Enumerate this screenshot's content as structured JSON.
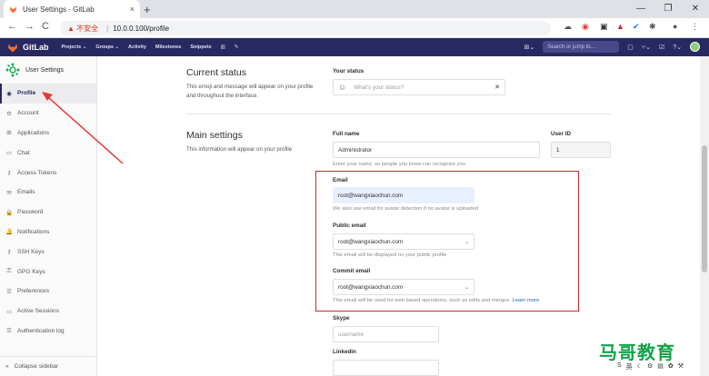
{
  "browser": {
    "tab_title": "User Settings · GitLab",
    "tab_close": "×",
    "new_tab": "+",
    "window_controls": [
      "—",
      "❐",
      "✕"
    ],
    "back": "←",
    "forward": "→",
    "reload": "C",
    "security_warning": "▲ 不安全",
    "url": "10.0.0.100/profile"
  },
  "gitlab_nav": {
    "brand": "GitLab",
    "menu": [
      "Projects ⌄",
      "Groups ⌄",
      "Activity",
      "Milestones",
      "Snippets"
    ],
    "search_placeholder": "Search or jump to…"
  },
  "sidebar": {
    "title": "User Settings",
    "items": [
      {
        "label": "Profile",
        "icon": "user-icon",
        "glyph": "◉",
        "active": true
      },
      {
        "label": "Account",
        "icon": "gear-icon",
        "glyph": "⚙"
      },
      {
        "label": "Applications",
        "icon": "applications-icon",
        "glyph": "⊞"
      },
      {
        "label": "Chat",
        "icon": "chat-icon",
        "glyph": "▭"
      },
      {
        "label": "Access Tokens",
        "icon": "key-icon",
        "glyph": "⚷"
      },
      {
        "label": "Emails",
        "icon": "mail-icon",
        "glyph": "✉"
      },
      {
        "label": "Password",
        "icon": "lock-icon",
        "glyph": "🔒"
      },
      {
        "label": "Notifications",
        "icon": "bell-icon",
        "glyph": "🔔"
      },
      {
        "label": "SSH Keys",
        "icon": "ssh-key-icon",
        "glyph": "⚷"
      },
      {
        "label": "GPG Keys",
        "icon": "gpg-key-icon",
        "glyph": "⚿"
      },
      {
        "label": "Preferences",
        "icon": "preferences-icon",
        "glyph": "☰"
      },
      {
        "label": "Active Sessions",
        "icon": "sessions-icon",
        "glyph": "▭"
      },
      {
        "label": "Authentication log",
        "icon": "log-icon",
        "glyph": "☰"
      }
    ],
    "collapse": "Collapse sidebar"
  },
  "status": {
    "title": "Current status",
    "description": "This emoji and message will appear on your profile and throughout the interface.",
    "label": "Your status",
    "placeholder": "What's your status?",
    "clear": "✕"
  },
  "main_settings": {
    "title": "Main settings",
    "description": "This information will appear on your profile",
    "full_name_label": "Full name",
    "full_name_value": "Administrator",
    "full_name_help": "Enter your name, so people you know can recognize you",
    "user_id_label": "User ID",
    "user_id_value": "1",
    "email_label": "Email",
    "email_value": "root@wangxiaochun.com",
    "email_help": "We also use email for avatar detection if no avatar is uploaded",
    "public_email_label": "Public email",
    "public_email_value": "root@wangxiaochun.com",
    "public_email_help": "This email will be displayed on your public profile",
    "commit_email_label": "Commit email",
    "commit_email_value": "root@wangxiaochun.com",
    "commit_email_help": "This email will be used for web based operations, such as edits and merges.",
    "learn_more": "Learn more",
    "skype_label": "Skype",
    "skype_placeholder": "username",
    "linkedin_label": "Linkedin"
  },
  "watermark": "马哥教育",
  "tray": [
    "S",
    "英",
    "☾",
    "⚙",
    "▤",
    "✿",
    "⚒"
  ],
  "colors": {
    "nav": "#292961",
    "highlight_box": "#d6232a",
    "link": "#1068bf"
  }
}
